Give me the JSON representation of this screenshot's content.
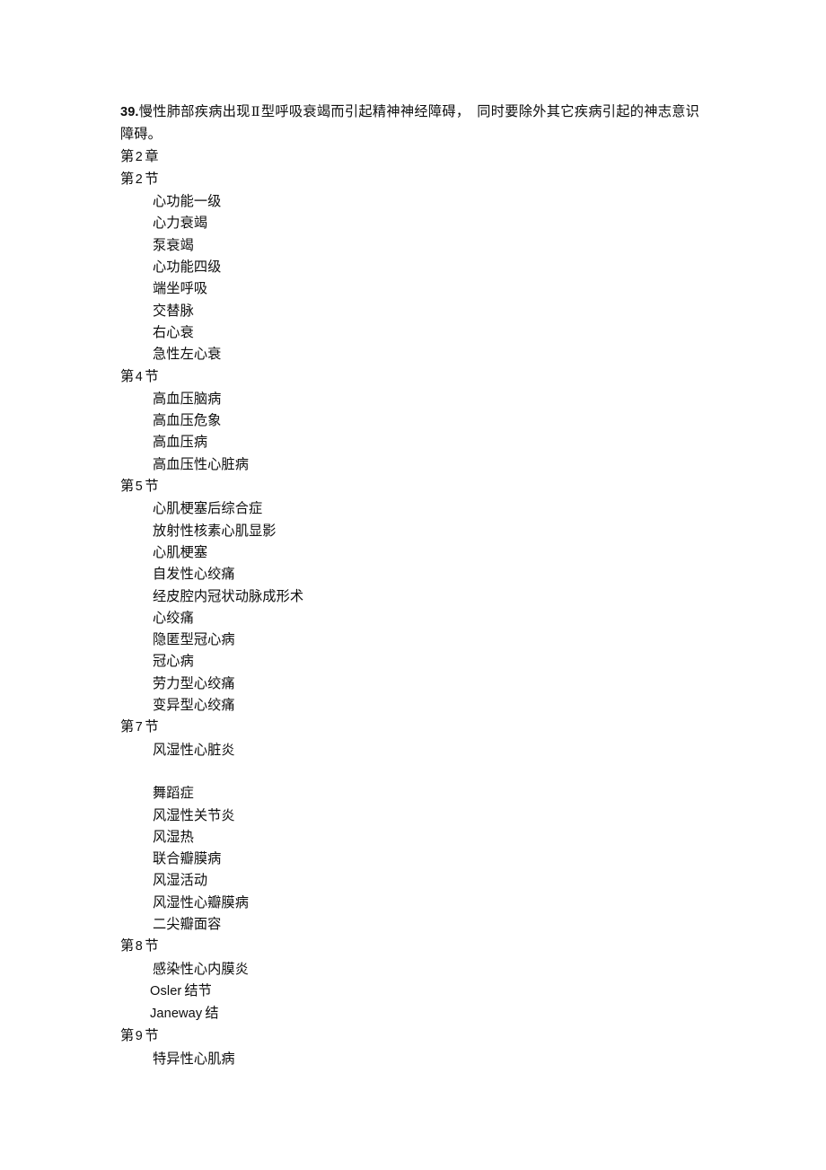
{
  "document": {
    "lead_paragraph": {
      "number": "39.",
      "text_before_roman": "慢性肺部疾病出现",
      "roman_numeral": "Ⅱ",
      "text_after_roman": "型呼吸衰竭而引起精神神经障碍，　同时要除外其它疾病引起的神志意识障碍。"
    },
    "chapter": {
      "prefix": "第",
      "number": "2",
      "suffix": "章"
    },
    "sections": [
      {
        "prefix": "第",
        "number": "2",
        "suffix": "节",
        "items": [
          {
            "text": "心功能一级"
          },
          {
            "text": "心力衰竭"
          },
          {
            "text": "泵衰竭"
          },
          {
            "text": "心功能四级"
          },
          {
            "text": "端坐呼吸"
          },
          {
            "text": "交替脉"
          },
          {
            "text": "右心衰"
          },
          {
            "text": "急性左心衰"
          }
        ]
      },
      {
        "prefix": "第",
        "number": "4",
        "suffix": "节",
        "items": [
          {
            "text": "高血压脑病"
          },
          {
            "text": "高血压危象"
          },
          {
            "text": "高血压病"
          },
          {
            "text": "高血压性心脏病"
          }
        ]
      },
      {
        "prefix": "第",
        "number": "5",
        "suffix": "节",
        "items": [
          {
            "text": "心肌梗塞后综合症"
          },
          {
            "text": "放射性核素心肌显影"
          },
          {
            "text": "心肌梗塞"
          },
          {
            "text": "自发性心绞痛"
          },
          {
            "text": "经皮腔内冠状动脉成形术"
          },
          {
            "text": "心绞痛"
          },
          {
            "text": "隐匿型冠心病"
          },
          {
            "text": "冠心病"
          },
          {
            "text": "劳力型心绞痛"
          },
          {
            "text": "变异型心绞痛"
          }
        ]
      },
      {
        "prefix": "第",
        "number": "7",
        "suffix": "节",
        "items": [
          {
            "text": "风湿性心脏炎"
          },
          {
            "text": "",
            "blank": true
          },
          {
            "text": "舞蹈症"
          },
          {
            "text": "风湿性关节炎"
          },
          {
            "text": "风湿热"
          },
          {
            "text": "联合瓣膜病"
          },
          {
            "text": "风湿活动"
          },
          {
            "text": "风湿性心瓣膜病"
          },
          {
            "text": "二尖瓣面容"
          }
        ]
      },
      {
        "prefix": "第",
        "number": "8",
        "suffix": "节",
        "items": [
          {
            "text": "感染性心内膜炎"
          },
          {
            "latin": "Osler",
            "text": "结节",
            "tight": true
          },
          {
            "latin": "Janeway",
            "text": "结",
            "tight": true
          }
        ]
      },
      {
        "prefix": "第",
        "number": "9",
        "suffix": "节",
        "items": [
          {
            "text": "特异性心肌病"
          }
        ]
      }
    ]
  }
}
